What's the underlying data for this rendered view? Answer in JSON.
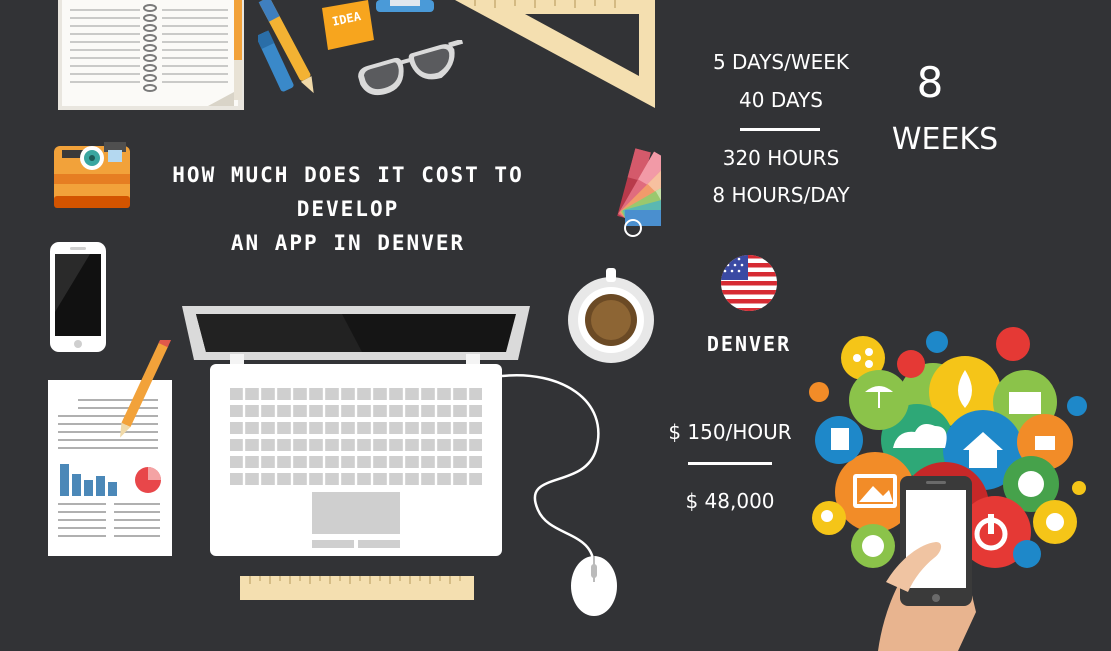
{
  "title": {
    "line1": "HOW MUCH DOES IT COST TO",
    "line2": "DEVELOP",
    "line3": "AN APP IN DENVER"
  },
  "schedule": {
    "days_per_week": "5 DAYS/WEEK",
    "days": "40 DAYS",
    "hours": "320 HOURS",
    "hours_per_day": "8 HOURS/DAY"
  },
  "duration": {
    "number": "8",
    "unit": "WEEKS"
  },
  "location": {
    "city": "DENVER"
  },
  "pricing": {
    "rate": "$ 150/HOUR",
    "total": "$ 48,000"
  },
  "sticky_note": {
    "text": "IDEA"
  },
  "colors": {
    "background": "#323336",
    "text": "#ffffff",
    "flag_red": "#d62b33",
    "flag_blue": "#3a4aa3"
  }
}
